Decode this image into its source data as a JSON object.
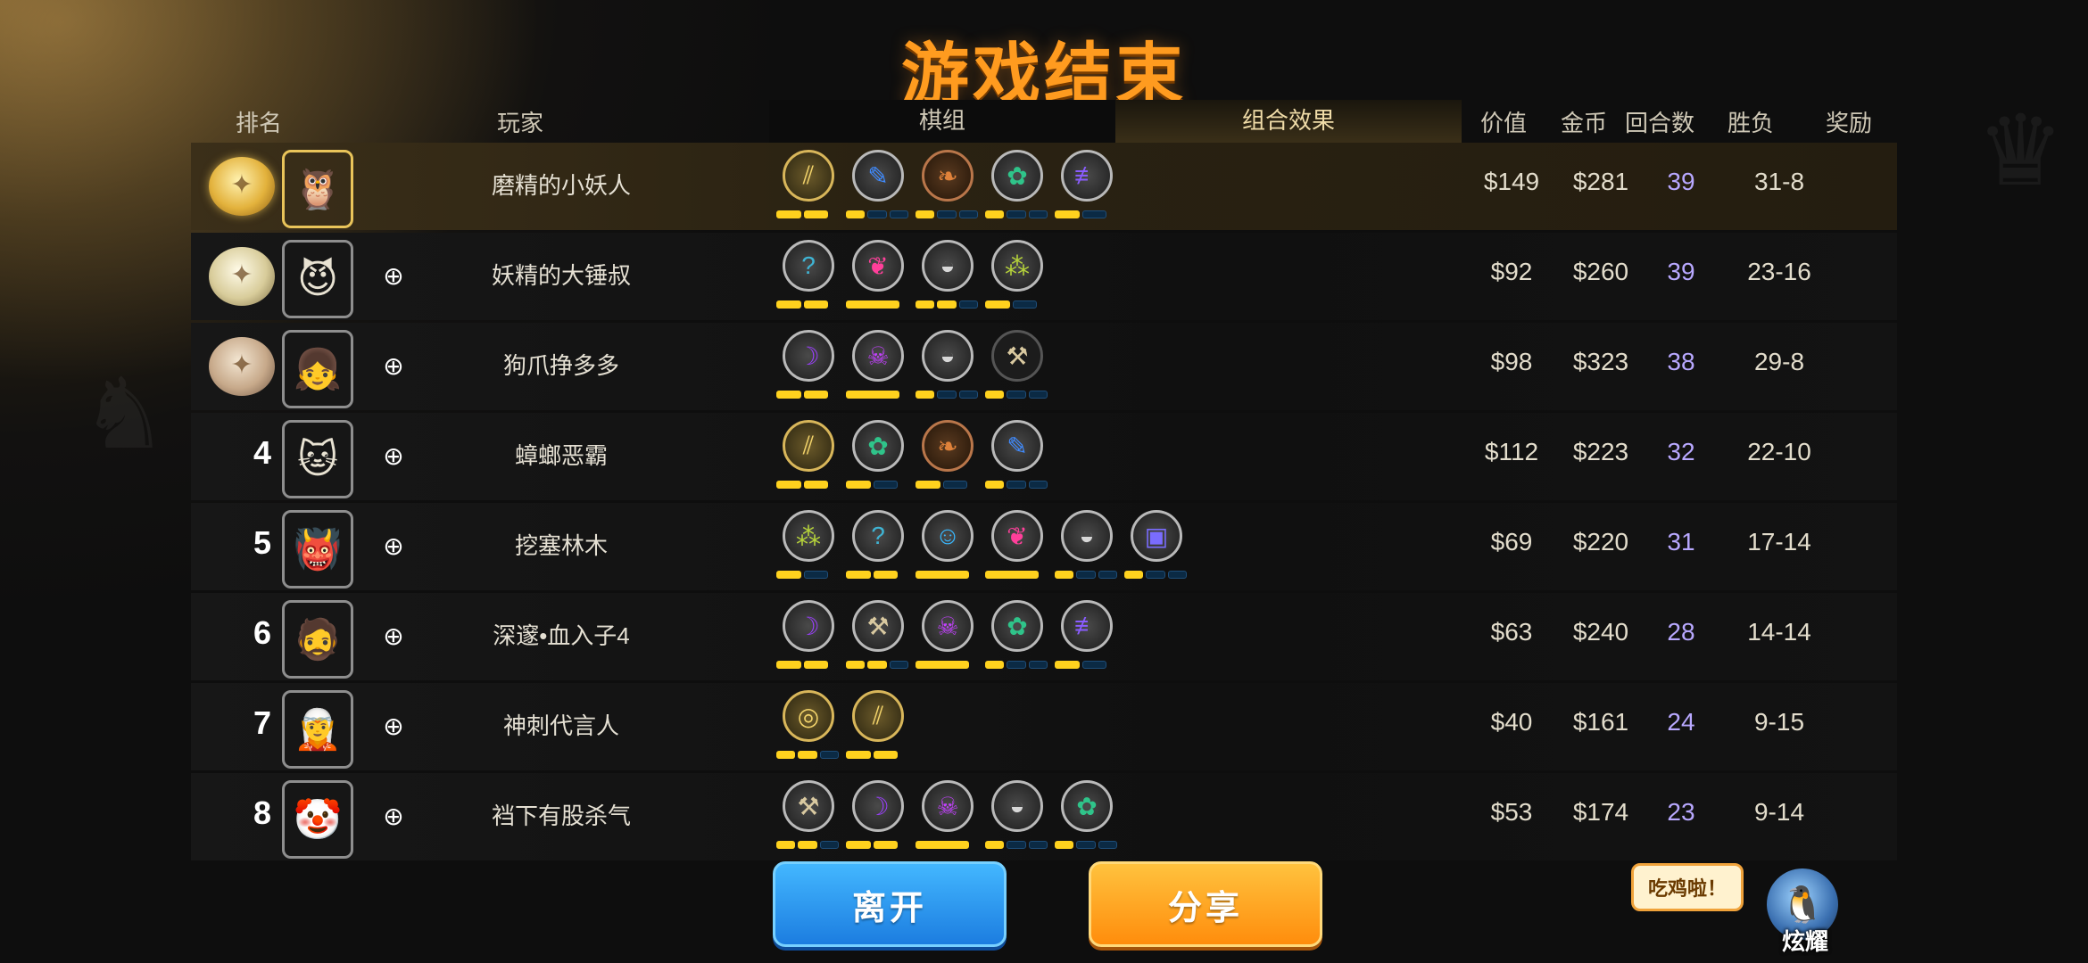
{
  "title": "游戏结束",
  "headers": {
    "rank": "排名",
    "player": "玩家",
    "lineup": "棋组",
    "synergy": "组合效果",
    "value": "价值",
    "gold": "金币",
    "rounds": "回合数",
    "winloss": "胜负",
    "reward": "奖励"
  },
  "rows": [
    {
      "rank": "",
      "medal": "gold",
      "avatar": "🦉",
      "name": "磨精的小妖人",
      "value": "$149",
      "gold": "$281",
      "rounds": "39",
      "wl": "31-8",
      "traits": [
        {
          "icon": "blade-icon",
          "glyph": "⫽",
          "tier": "gold",
          "pips": [
            1,
            1
          ]
        },
        {
          "icon": "feather-icon",
          "glyph": "✎",
          "tier": "silver",
          "pips": [
            1,
            0,
            0
          ]
        },
        {
          "icon": "leaf-icon",
          "glyph": "❧",
          "tier": "bronze",
          "pips": [
            1,
            0,
            0
          ]
        },
        {
          "icon": "paw-icon",
          "glyph": "✿",
          "tier": "silver",
          "pips": [
            1,
            0,
            0
          ]
        },
        {
          "icon": "fishbone-icon",
          "glyph": "≢",
          "tier": "silver",
          "pips": [
            1,
            0
          ]
        }
      ]
    },
    {
      "rank": "",
      "medal": "silver",
      "avatar": "😈",
      "name": "妖精的大锤叔",
      "value": "$92",
      "gold": "$260",
      "rounds": "39",
      "wl": "23-16",
      "traits": [
        {
          "icon": "question-icon",
          "glyph": "?",
          "tier": "silver",
          "pips": [
            1,
            1
          ]
        },
        {
          "icon": "bat-icon",
          "glyph": "❦",
          "tier": "silver",
          "pips": [
            1
          ]
        },
        {
          "icon": "helmet-icon",
          "glyph": "◒",
          "tier": "silver",
          "pips": [
            1,
            1,
            0
          ]
        },
        {
          "icon": "cluster-icon",
          "glyph": "⁂",
          "tier": "silver",
          "pips": [
            1,
            0
          ]
        }
      ]
    },
    {
      "rank": "",
      "medal": "bronze",
      "avatar": "👧",
      "name": "狗爪挣多多",
      "value": "$98",
      "gold": "$323",
      "rounds": "38",
      "wl": "29-8",
      "traits": [
        {
          "icon": "hood-icon",
          "glyph": "☽",
          "tier": "silver",
          "pips": [
            1,
            1
          ]
        },
        {
          "icon": "demon-icon",
          "glyph": "☠",
          "tier": "silver",
          "pips": [
            1
          ]
        },
        {
          "icon": "helmet-icon",
          "glyph": "◒",
          "tier": "silver",
          "pips": [
            1,
            0,
            0
          ]
        },
        {
          "icon": "axe-icon",
          "glyph": "⚒",
          "tier": "none",
          "pips": [
            1,
            0,
            0
          ]
        }
      ]
    },
    {
      "rank": "4",
      "medal": "",
      "avatar": "🐱",
      "name": "蟑螂恶霸",
      "value": "$112",
      "gold": "$223",
      "rounds": "32",
      "wl": "22-10",
      "traits": [
        {
          "icon": "blade-icon",
          "glyph": "⫽",
          "tier": "gold",
          "pips": [
            1,
            1
          ]
        },
        {
          "icon": "paw-icon",
          "glyph": "✿",
          "tier": "silver",
          "pips": [
            1,
            0
          ]
        },
        {
          "icon": "leaf-icon",
          "glyph": "❧",
          "tier": "bronze",
          "pips": [
            1,
            0
          ]
        },
        {
          "icon": "feather-icon",
          "glyph": "✎",
          "tier": "silver",
          "pips": [
            1,
            0,
            0
          ]
        }
      ]
    },
    {
      "rank": "5",
      "medal": "",
      "avatar": "👹",
      "name": "挖塞林木",
      "value": "$69",
      "gold": "$220",
      "rounds": "31",
      "wl": "17-14",
      "traits": [
        {
          "icon": "cluster-icon",
          "glyph": "⁂",
          "tier": "silver",
          "pips": [
            1,
            0
          ]
        },
        {
          "icon": "question-icon",
          "glyph": "?",
          "tier": "silver",
          "pips": [
            1,
            1
          ]
        },
        {
          "icon": "pumpkin-icon",
          "glyph": "☺",
          "tier": "silver",
          "pips": [
            1
          ]
        },
        {
          "icon": "bat-icon",
          "glyph": "❦",
          "tier": "silver",
          "pips": [
            1
          ]
        },
        {
          "icon": "helmet-icon",
          "glyph": "◒",
          "tier": "silver",
          "pips": [
            1,
            0,
            0
          ]
        },
        {
          "icon": "screen-icon",
          "glyph": "▣",
          "tier": "silver",
          "pips": [
            1,
            0,
            0
          ]
        }
      ]
    },
    {
      "rank": "6",
      "medal": "",
      "avatar": "🧔",
      "name": "深邃•血入子4",
      "value": "$63",
      "gold": "$240",
      "rounds": "28",
      "wl": "14-14",
      "traits": [
        {
          "icon": "hood-icon",
          "glyph": "☽",
          "tier": "silver",
          "pips": [
            1,
            1
          ]
        },
        {
          "icon": "axe-icon",
          "glyph": "⚒",
          "tier": "silver",
          "pips": [
            1,
            1,
            0
          ]
        },
        {
          "icon": "demon-icon",
          "glyph": "☠",
          "tier": "silver",
          "pips": [
            1
          ]
        },
        {
          "icon": "paw-icon",
          "glyph": "✿",
          "tier": "silver",
          "pips": [
            1,
            0,
            0
          ]
        },
        {
          "icon": "fishbone-icon",
          "glyph": "≢",
          "tier": "silver",
          "pips": [
            1,
            0
          ]
        }
      ]
    },
    {
      "rank": "7",
      "medal": "",
      "avatar": "🧝",
      "name": "神刺代言人",
      "value": "$40",
      "gold": "$161",
      "rounds": "24",
      "wl": "9-15",
      "traits": [
        {
          "icon": "ring-icon",
          "glyph": "◎",
          "tier": "gold",
          "pips": [
            1,
            1,
            0
          ]
        },
        {
          "icon": "blade-icon",
          "glyph": "⫽",
          "tier": "gold",
          "pips": [
            1,
            1
          ]
        }
      ]
    },
    {
      "rank": "8",
      "medal": "",
      "avatar": "🤡",
      "name": "裆下有股杀气",
      "value": "$53",
      "gold": "$174",
      "rounds": "23",
      "wl": "9-14",
      "traits": [
        {
          "icon": "axe-icon",
          "glyph": "⚒",
          "tier": "silver",
          "pips": [
            1,
            1,
            0
          ]
        },
        {
          "icon": "hood-icon",
          "glyph": "☽",
          "tier": "silver",
          "pips": [
            1,
            1
          ]
        },
        {
          "icon": "demon-icon",
          "glyph": "☠",
          "tier": "silver",
          "pips": [
            1
          ]
        },
        {
          "icon": "helmet-icon",
          "glyph": "◒",
          "tier": "silver",
          "pips": [
            1,
            0,
            0
          ]
        },
        {
          "icon": "paw-icon",
          "glyph": "✿",
          "tier": "silver",
          "pips": [
            1,
            0,
            0
          ]
        }
      ]
    }
  ],
  "trait_colors": {
    "blade-icon": "#f2d36a",
    "feather-icon": "#3f8bff",
    "leaf-icon": "#e0823a",
    "paw-icon": "#2fc48a",
    "fishbone-icon": "#8a5cff",
    "question-icon": "#3fb4d4",
    "bat-icon": "#ff3f9a",
    "helmet-icon": "#d8d8d8",
    "cluster-icon": "#b5d23a",
    "hood-icon": "#9b3fff",
    "demon-icon": "#c33fff",
    "axe-icon": "#d9c9a0",
    "pumpkin-icon": "#38b8ff",
    "screen-icon": "#7a6cff",
    "ring-icon": "#f2d36a"
  },
  "buttons": {
    "leave": "离开",
    "share": "分享"
  },
  "bubble": "吃鸡啦！",
  "flaunt": "炫耀"
}
